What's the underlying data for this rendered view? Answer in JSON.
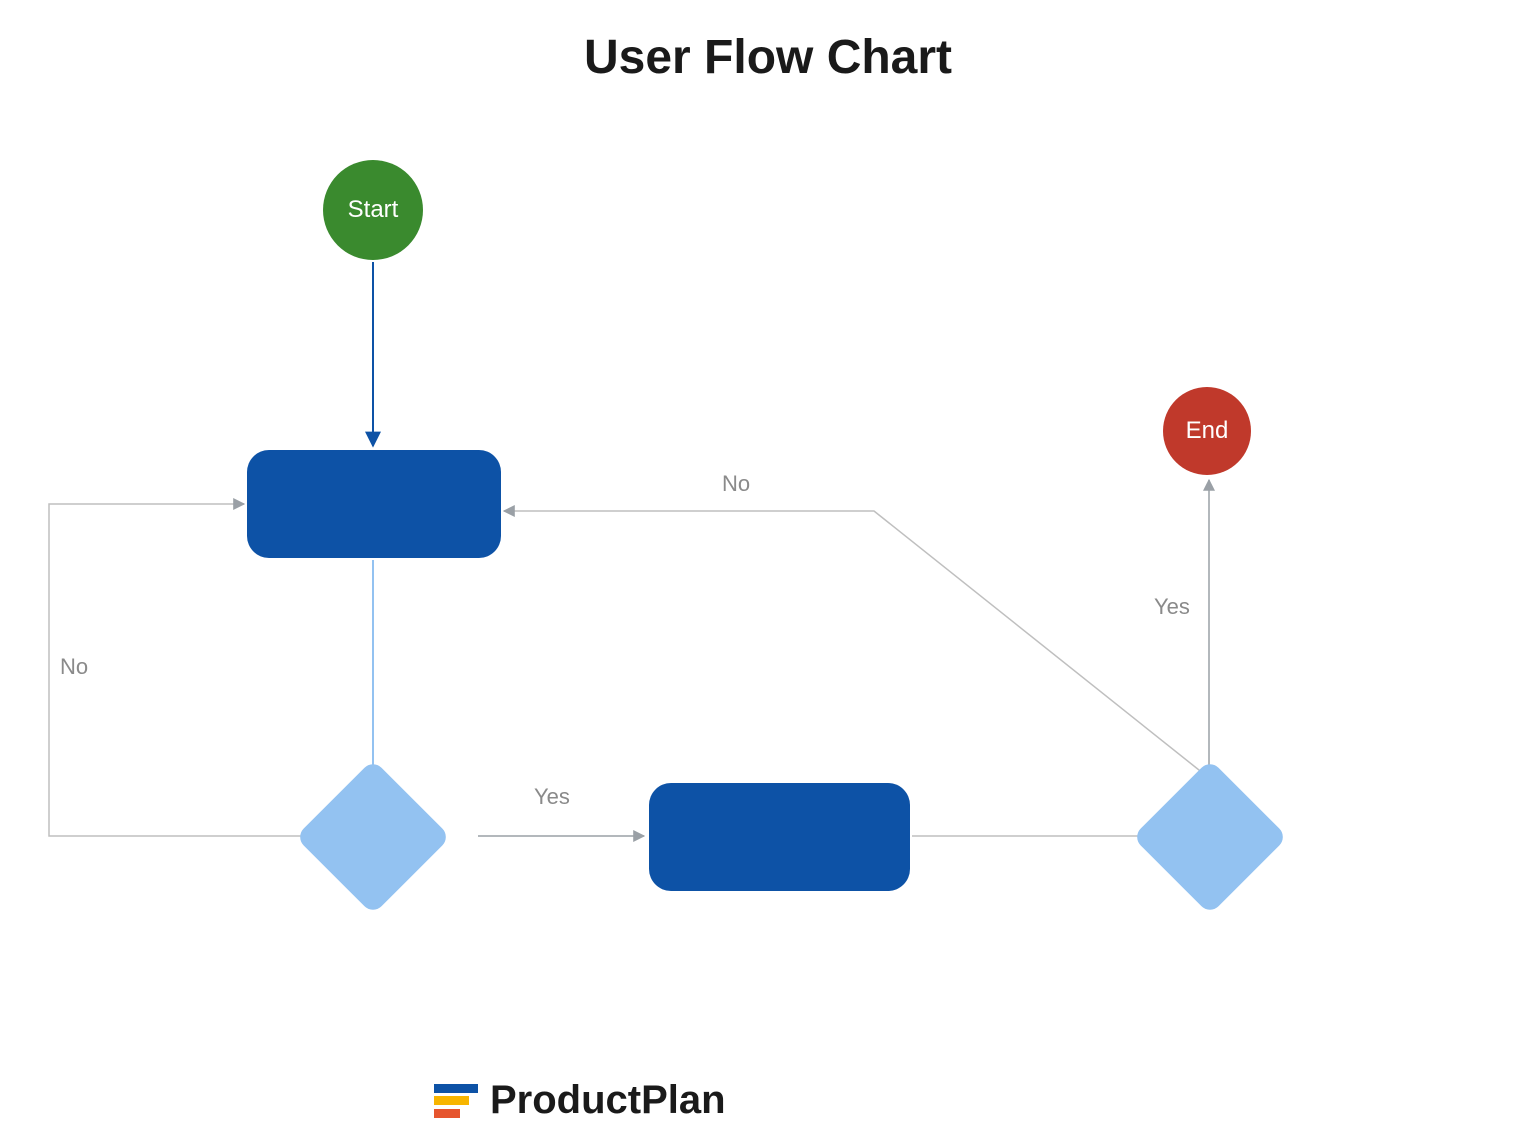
{
  "title": "User Flow Chart",
  "nodes": {
    "start": {
      "label": "Start"
    },
    "end": {
      "label": "End"
    },
    "process1": {
      "label": ""
    },
    "process2": {
      "label": ""
    },
    "decision1": {
      "label": ""
    },
    "decision2": {
      "label": ""
    }
  },
  "edges": {
    "start_to_process1": {
      "label": ""
    },
    "process1_to_decision1": {
      "label": ""
    },
    "decision1_no": {
      "label": "No"
    },
    "decision1_yes": {
      "label": "Yes"
    },
    "process2_to_decision2": {
      "label": ""
    },
    "decision2_no": {
      "label": "No"
    },
    "decision2_yes": {
      "label": "Yes"
    }
  },
  "brand": {
    "name": "ProductPlan"
  },
  "colors": {
    "start": "#3a8a2e",
    "end": "#c0392b",
    "process": "#0d52a6",
    "decision": "#93c2f1",
    "edge_primary": "#0d52a6",
    "edge_secondary": "#9aa0a6"
  }
}
